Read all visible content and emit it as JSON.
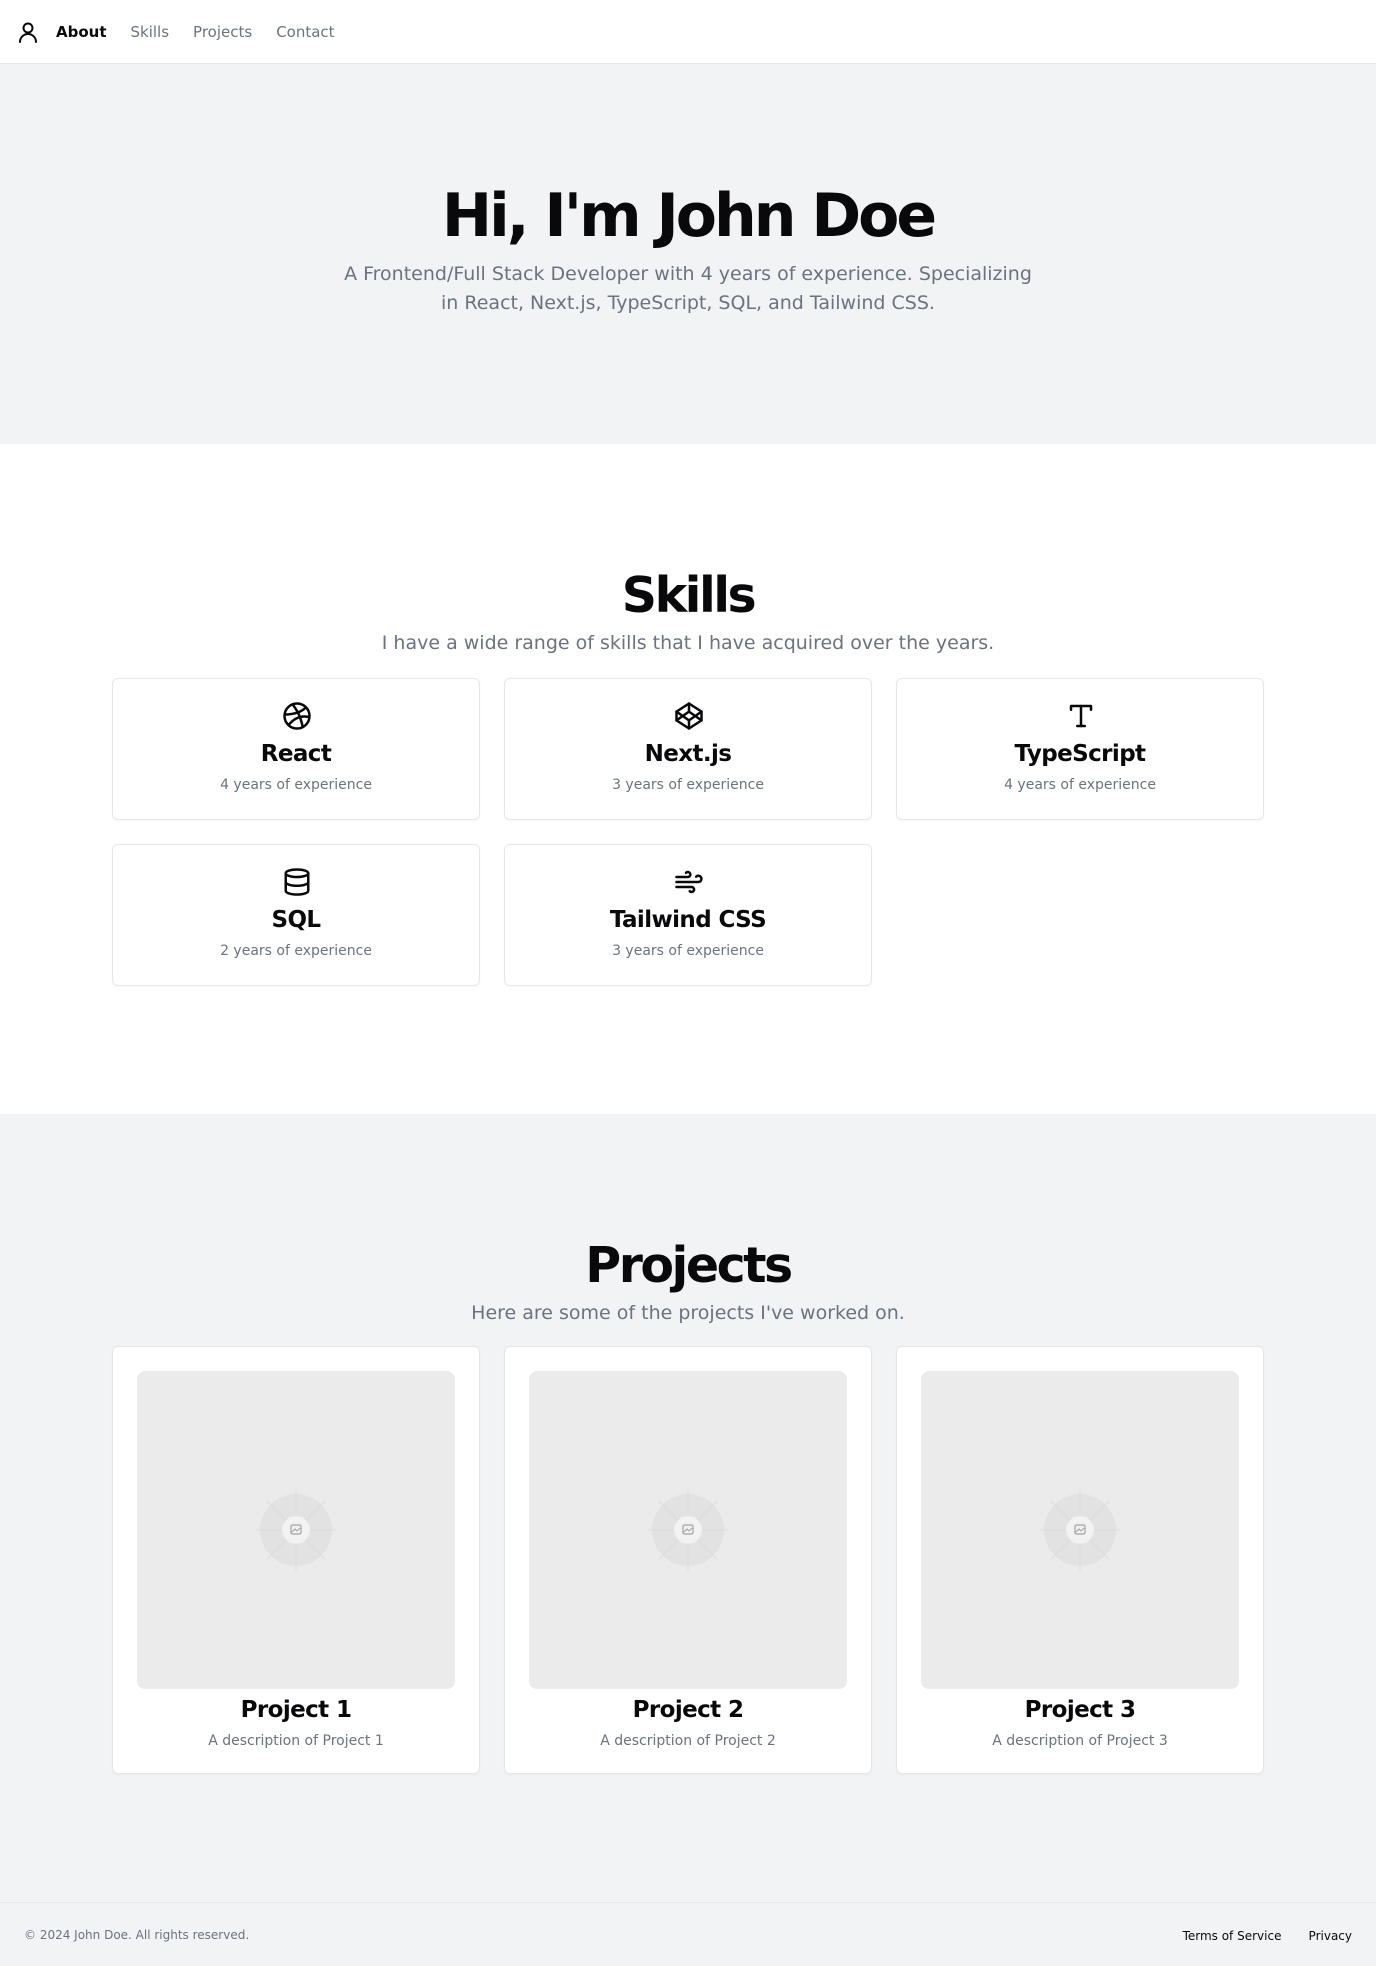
{
  "nav": {
    "icon": "user-icon",
    "items": [
      {
        "label": "About",
        "active": true
      },
      {
        "label": "Skills",
        "active": false
      },
      {
        "label": "Projects",
        "active": false
      },
      {
        "label": "Contact",
        "active": false
      }
    ]
  },
  "hero": {
    "title": "Hi, I'm John Doe",
    "subtitle": "A Frontend/Full Stack Developer with 4 years of experience. Specializing in React, Next.js, TypeScript, SQL, and Tailwind CSS."
  },
  "skills": {
    "title": "Skills",
    "subtitle": "I have a wide range of skills that I have acquired over the years.",
    "items": [
      {
        "name": "React",
        "experience": "4 years of experience",
        "icon": "dribbble-icon"
      },
      {
        "name": "Next.js",
        "experience": "3 years of experience",
        "icon": "codepen-icon"
      },
      {
        "name": "TypeScript",
        "experience": "4 years of experience",
        "icon": "type-icon"
      },
      {
        "name": "SQL",
        "experience": "2 years of experience",
        "icon": "database-icon"
      },
      {
        "name": "Tailwind CSS",
        "experience": "3 years of experience",
        "icon": "wind-icon"
      }
    ]
  },
  "projects": {
    "title": "Projects",
    "subtitle": "Here are some of the projects I've worked on.",
    "items": [
      {
        "name": "Project 1",
        "description": "A description of Project 1",
        "image_icon": "image-placeholder-icon"
      },
      {
        "name": "Project 2",
        "description": "A description of Project 2",
        "image_icon": "image-placeholder-icon"
      },
      {
        "name": "Project 3",
        "description": "A description of Project 3",
        "image_icon": "image-placeholder-icon"
      }
    ]
  },
  "footer": {
    "copyright": "© 2024 John Doe. All rights reserved.",
    "links": [
      "Terms of Service",
      "Privacy"
    ]
  }
}
